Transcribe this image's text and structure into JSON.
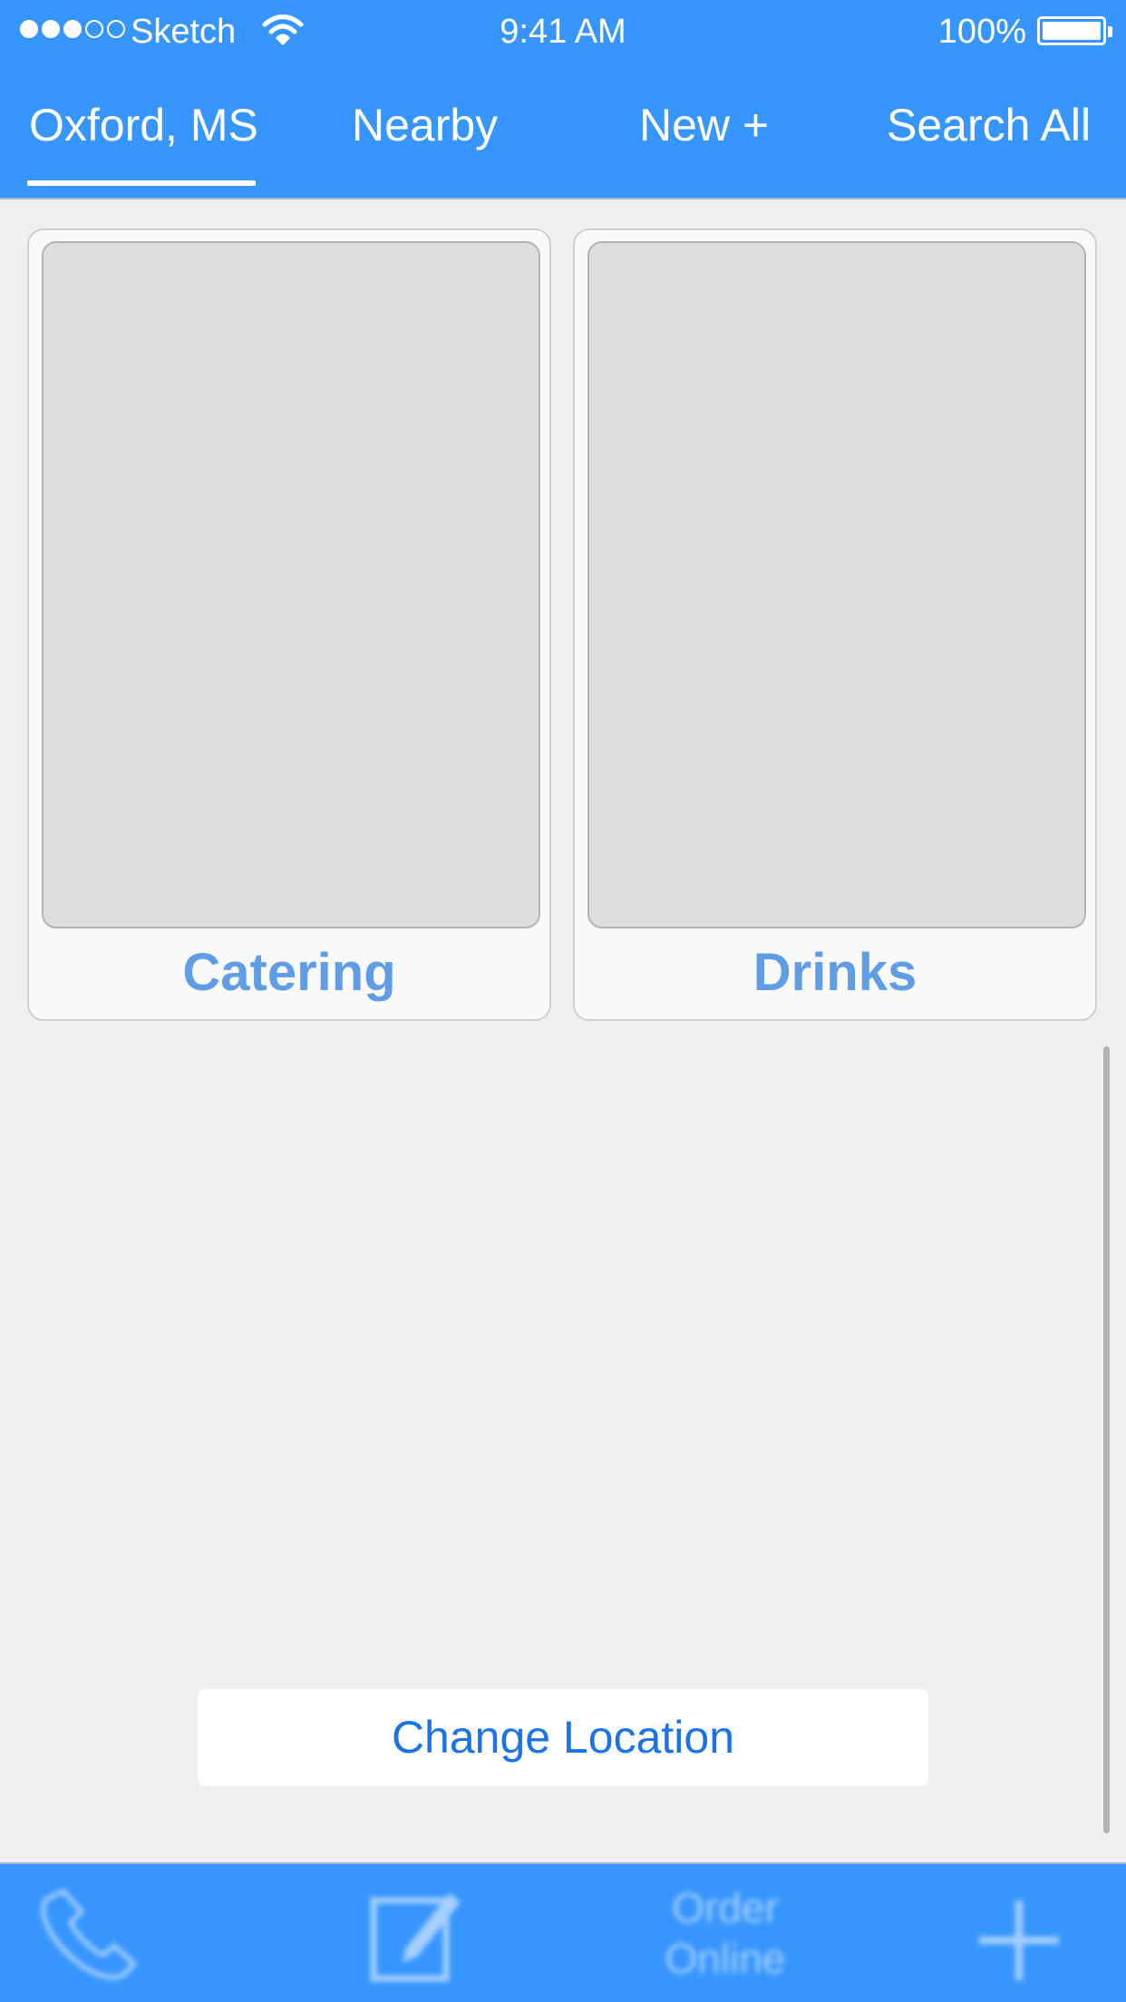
{
  "status_bar": {
    "signal_filled": 3,
    "signal_total": 5,
    "carrier": "Sketch",
    "time": "9:41 AM",
    "battery_percent": "100%",
    "battery_level": 1.0,
    "wifi_icon": "wifi-icon"
  },
  "tabs": [
    {
      "label": "Oxford, MS",
      "selected": true
    },
    {
      "label": "Nearby",
      "selected": false
    },
    {
      "label": "New +",
      "selected": false
    },
    {
      "label": "Search All",
      "selected": false
    }
  ],
  "cards": [
    {
      "label": "Catering",
      "image_icon": "image-placeholder"
    },
    {
      "label": "Drinks",
      "image_icon": "image-placeholder"
    }
  ],
  "change_location": {
    "label": "Change Location"
  },
  "bottom_bar": {
    "items": [
      {
        "icon": "phone-icon"
      },
      {
        "icon": "compose-icon"
      },
      {
        "label_line1": "Order",
        "label_line2": "Online"
      },
      {
        "icon": "plus-icon"
      }
    ]
  },
  "colors": {
    "accent": "#3796fe",
    "card_label": "#5f9ee7",
    "button_text": "#1a73e8",
    "background": "#efefef"
  }
}
